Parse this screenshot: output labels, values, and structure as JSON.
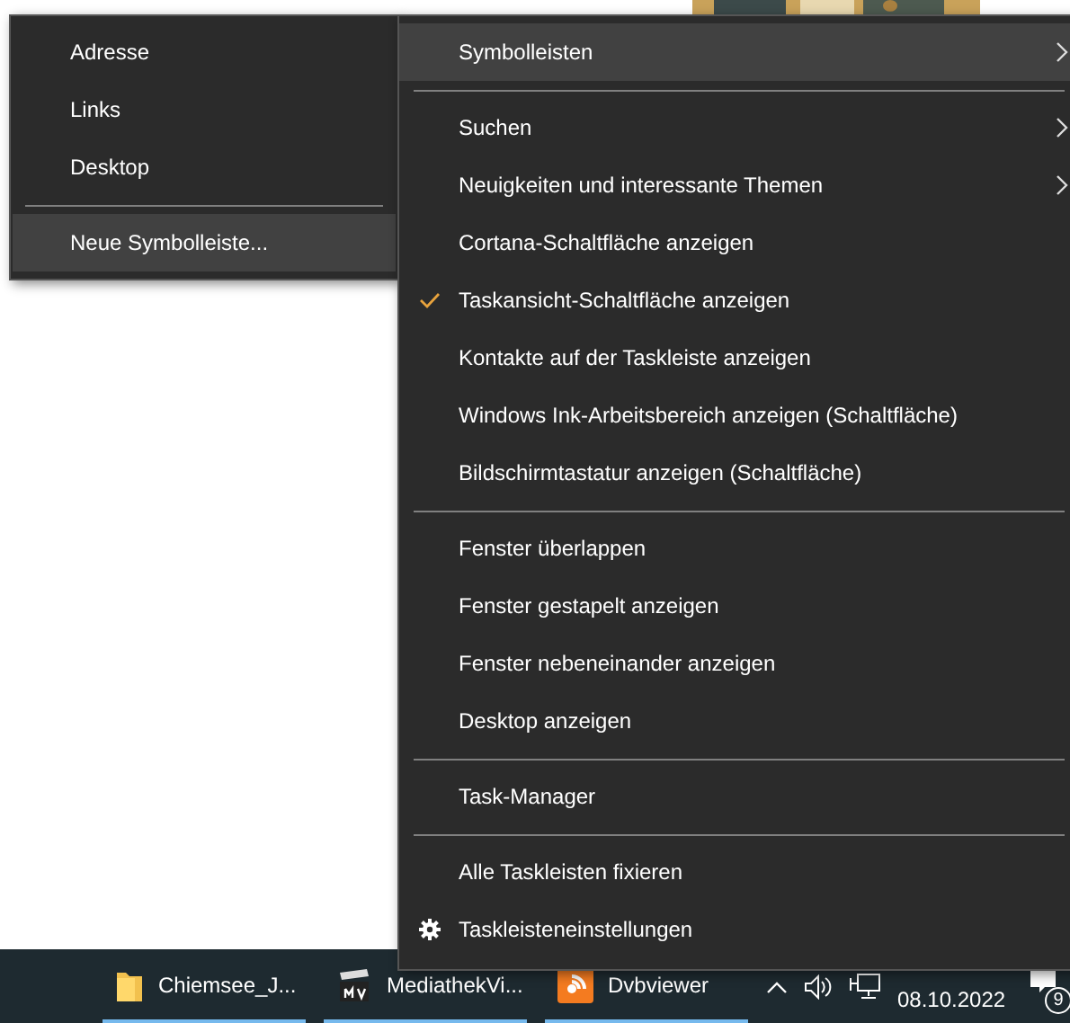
{
  "toolbars_submenu": {
    "items": [
      {
        "kind": "item",
        "label": "Adresse",
        "highlighted": false
      },
      {
        "kind": "item",
        "label": "Links",
        "highlighted": false
      },
      {
        "kind": "item",
        "label": "Desktop",
        "highlighted": false
      },
      {
        "kind": "separator"
      },
      {
        "kind": "item",
        "label": "Neue Symbolleiste...",
        "highlighted": true
      }
    ]
  },
  "context_menu": {
    "items": [
      {
        "kind": "item",
        "label": "Symbolleisten",
        "highlighted": true,
        "submenu": true,
        "checked": false
      },
      {
        "kind": "separator"
      },
      {
        "kind": "item",
        "label": "Suchen",
        "highlighted": false,
        "submenu": true,
        "checked": false
      },
      {
        "kind": "item",
        "label": "Neuigkeiten und interessante Themen",
        "highlighted": false,
        "submenu": true,
        "checked": false
      },
      {
        "kind": "item",
        "label": "Cortana-Schaltfläche anzeigen",
        "highlighted": false,
        "submenu": false,
        "checked": false
      },
      {
        "kind": "item",
        "label": "Taskansicht-Schaltfläche anzeigen",
        "highlighted": false,
        "submenu": false,
        "checked": true
      },
      {
        "kind": "item",
        "label": "Kontakte auf der Taskleiste anzeigen",
        "highlighted": false,
        "submenu": false,
        "checked": false
      },
      {
        "kind": "item",
        "label": "Windows Ink-Arbeitsbereich anzeigen (Schaltfläche)",
        "highlighted": false,
        "submenu": false,
        "checked": false
      },
      {
        "kind": "item",
        "label": "Bildschirmtastatur anzeigen (Schaltfläche)",
        "highlighted": false,
        "submenu": false,
        "checked": false
      },
      {
        "kind": "separator"
      },
      {
        "kind": "item",
        "label": "Fenster überlappen",
        "highlighted": false,
        "submenu": false,
        "checked": false
      },
      {
        "kind": "item",
        "label": "Fenster gestapelt anzeigen",
        "highlighted": false,
        "submenu": false,
        "checked": false
      },
      {
        "kind": "item",
        "label": "Fenster nebeneinander anzeigen",
        "highlighted": false,
        "submenu": false,
        "checked": false
      },
      {
        "kind": "item",
        "label": "Desktop anzeigen",
        "highlighted": false,
        "submenu": false,
        "checked": false
      },
      {
        "kind": "separator"
      },
      {
        "kind": "item",
        "label": "Task-Manager",
        "highlighted": false,
        "submenu": false,
        "checked": false
      },
      {
        "kind": "separator"
      },
      {
        "kind": "item",
        "label": "Alle Taskleisten fixieren",
        "highlighted": false,
        "submenu": false,
        "checked": false
      },
      {
        "kind": "settings",
        "label": "Taskleisteneinstellungen",
        "highlighted": false,
        "submenu": false,
        "checked": false
      }
    ]
  },
  "taskbar": {
    "apps": [
      {
        "kind": "folder",
        "label": "Chiemsee_J..."
      },
      {
        "kind": "mv",
        "label": "MediathekVi..."
      },
      {
        "kind": "dvb",
        "label": "Dvbviewer"
      }
    ],
    "date": "08.10.2022",
    "notification_count": "9"
  }
}
